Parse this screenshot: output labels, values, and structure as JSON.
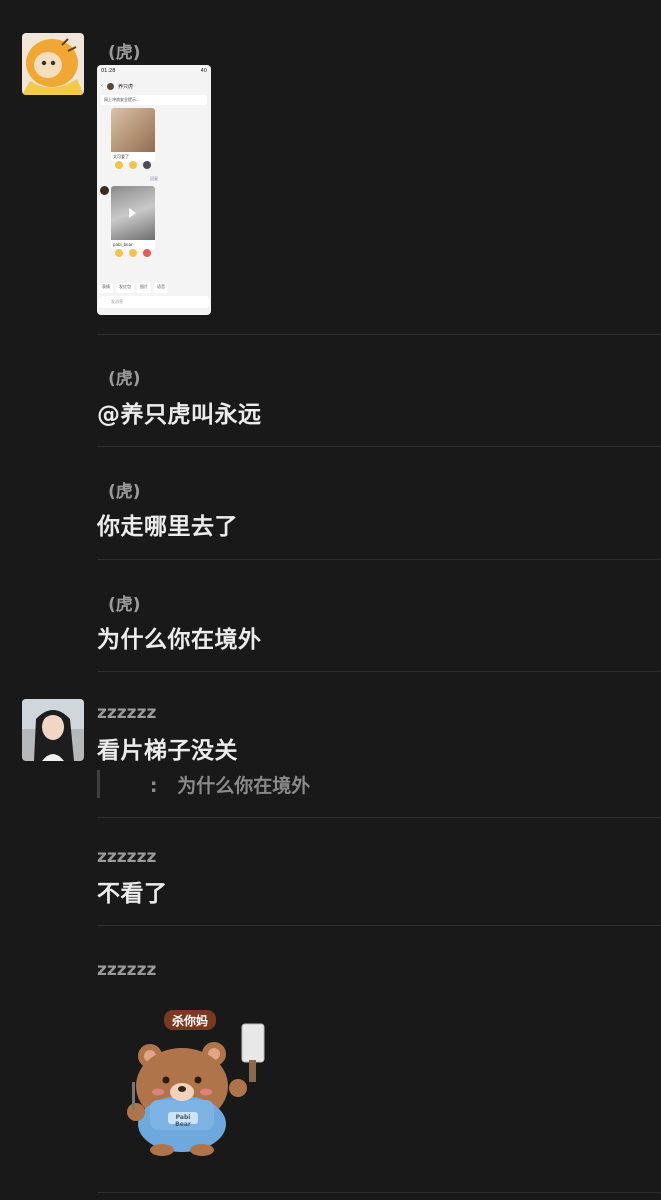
{
  "messages": [
    {
      "sender": "(虎)",
      "attachment": "phone-screenshot"
    },
    {
      "sender": "(虎)",
      "text": "@养只虎叫永远"
    },
    {
      "sender": "(虎)",
      "text": "你走哪里去了"
    },
    {
      "sender": "(虎)",
      "text": "为什么你在境外"
    },
    {
      "sender": "zzzzzz",
      "text": "看片梯子没关",
      "quote": "   :   为什么你在境外"
    },
    {
      "sender": "zzzzzz",
      "text": "不看了"
    },
    {
      "sender": "zzzzzz",
      "sticker": {
        "caption": "杀你妈",
        "badge": "Pabi Bear"
      }
    }
  ],
  "screenshot": {
    "time": "01:28",
    "battery": "40",
    "chat_title": "养只虎",
    "notice": "网上冲浪安全提示...",
    "caption1": "太可爱了",
    "caption2": "pabi_bear",
    "emoji1": [
      "赞",
      "可爱",
      "哈哈"
    ],
    "emoji2": [
      "笑哭了",
      "酷",
      "爱你"
    ],
    "tag": "回复",
    "quick_replies": [
      "表情",
      "发红包",
      "图片",
      "语音",
      "位置"
    ],
    "input_placeholder": "发消息"
  }
}
